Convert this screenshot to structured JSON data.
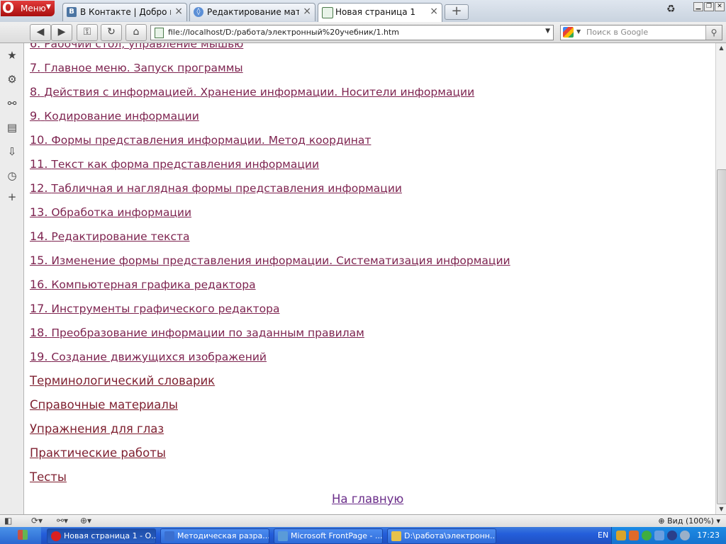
{
  "browser": {
    "menu_label": "Меню",
    "tabs": [
      {
        "label": "В Контакте | Добро по..."
      },
      {
        "label": "Редактирование матер..."
      },
      {
        "label": "Новая страница 1"
      }
    ],
    "address": "file://localhost/D:/работа/электронный%20учебник/1.htm",
    "search_placeholder": "Поиск в Google",
    "zoom": "Вид (100%)"
  },
  "page": {
    "items": [
      {
        "num": "6.",
        "text": "Рабочий стол, управление мышью"
      },
      {
        "num": "7.",
        "text": "Главное меню. Запуск программы"
      },
      {
        "num": "8.",
        "text": "Действия с информацией. Хранение информации. Носители информации"
      },
      {
        "num": "9.",
        "text": "Кодирование информации"
      },
      {
        "num": "10.",
        "text": "Формы представления информации. Метод координат"
      },
      {
        "num": "11.",
        "text": "Текст как форма представления информации"
      },
      {
        "num": "12.",
        "text": "Табличная и наглядная формы представления информации"
      },
      {
        "num": "13.",
        "text": "Обработка информации"
      },
      {
        "num": "14.",
        "text": "Редактирование текста"
      },
      {
        "num": "15.",
        "text": " Изменение формы представления информации. Систематизация информации"
      },
      {
        "num": "16.",
        "text": "Компьютерная графика редактора"
      },
      {
        "num": "17.",
        "text": "Инструменты графического редактора"
      },
      {
        "num": "18.",
        "text": "Преобразование информации по заданным правилам"
      },
      {
        "num": "19.",
        "text": "Создание движущихся изображений"
      }
    ],
    "sections": [
      "Терминологический словарик",
      "Справочные материалы",
      "Упражнения для глаз",
      "Практические работы",
      "Тесты"
    ],
    "home_link": "На главную"
  },
  "taskbar": {
    "tasks": [
      {
        "label": "Новая страница 1 - О...",
        "icon_color": "#d92020"
      },
      {
        "label": "Методическая разра...",
        "icon_color": "#3a6fd0"
      },
      {
        "label": "Microsoft FrontPage - ...",
        "icon_color": "#5a9bd8"
      },
      {
        "label": "D:\\работа\\электронн...",
        "icon_color": "#e6c24a"
      }
    ],
    "lang": "EN",
    "clock": "17:23"
  }
}
